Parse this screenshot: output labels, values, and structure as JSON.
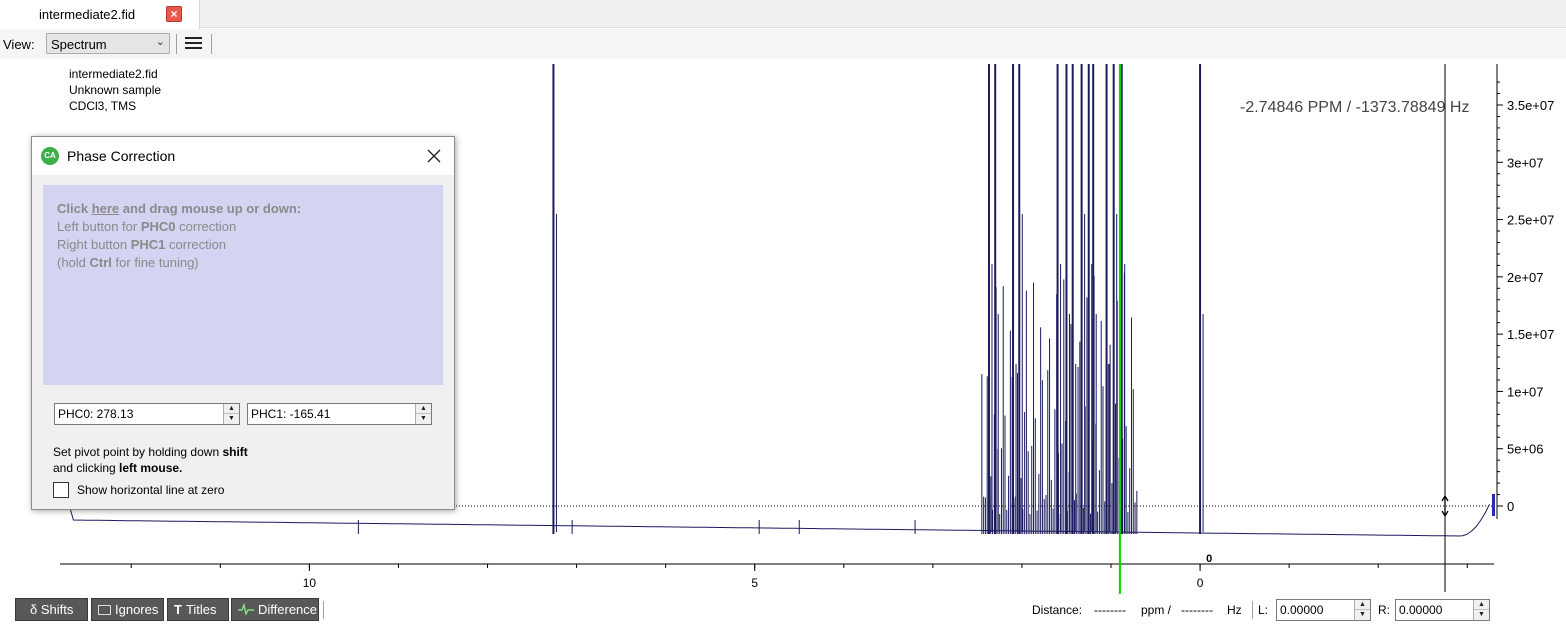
{
  "tab": {
    "title": "intermediate2.fid",
    "close_icon": "close-icon"
  },
  "toolbar": {
    "view_label": "View:",
    "view_value": "Spectrum",
    "menu_icon": "hamburger-menu-icon"
  },
  "spectrum_info": {
    "filename": "intermediate2.fid",
    "sample": "Unknown sample",
    "solvent": "CDCl3, TMS"
  },
  "cursor_readout": "-2.74846 PPM / -1373.78849 Hz",
  "chart_data": {
    "type": "line",
    "x_ticks": [
      "10",
      "5",
      "0"
    ],
    "x_tick_values": [
      10,
      5,
      0
    ],
    "y_ticks": [
      "0",
      "5e+06",
      "1e+07",
      "1.5e+07",
      "2e+07",
      "2.5e+07",
      "3e+07",
      "3.5e+07"
    ],
    "y_tick_values": [
      0,
      5000000,
      10000000,
      15000000,
      20000000,
      25000000,
      30000000,
      35000000
    ],
    "xlim": [
      12.8,
      -3.3
    ],
    "ylim": [
      -2000000,
      38000000
    ],
    "zero_marker_label": "0",
    "peaks_ppm": [
      7.26,
      2.37,
      2.3,
      2.1,
      2.03,
      1.6,
      1.5,
      1.43,
      1.33,
      1.25,
      1.2,
      1.05,
      0.97,
      0.88,
      0.0
    ],
    "cursor_ppm": -2.75,
    "pivot_ppm": 0.9,
    "colors": {
      "spectrum": "#1b1b5e",
      "pivot": "#00dd00",
      "cursor": "#000000"
    }
  },
  "dialog": {
    "title": "Phase Correction",
    "icon": "ca-app-icon",
    "drag": {
      "click": "Click ",
      "here": "here",
      "and_drag": " and drag mouse up or down:",
      "left_prefix": "Left button for ",
      "left_bold": "PHC0",
      "left_suffix": " correction",
      "right_prefix": "Right button ",
      "right_bold": "PHC1",
      "right_suffix": " correction",
      "hold_prefix": "(hold ",
      "hold_bold": "Ctrl",
      "hold_suffix": " for fine tuning)"
    },
    "phc0": "PHC0: 278.13",
    "phc1": "PHC1: -165.41",
    "pivot": {
      "line1_prefix": "Set pivot point by holding down ",
      "line1_bold": "shift",
      "line2_prefix": "and clicking ",
      "line2_bold": "left mouse."
    },
    "zero_line_label": "Show horizontal line at zero"
  },
  "bottom": {
    "shifts": "δ Shifts",
    "ignores": "Ignores",
    "titles_icon": "T",
    "titles": "Titles",
    "difference_icon": "-/\\-",
    "difference": "Difference",
    "distance_label": "Distance:",
    "dist_ppm_value": "--------",
    "ppm_unit": "ppm /",
    "dist_hz_value": "--------",
    "hz_unit": "Hz",
    "l_label": "L:",
    "l_value": "0.00000",
    "r_label": "R:",
    "r_value": "0.00000"
  }
}
